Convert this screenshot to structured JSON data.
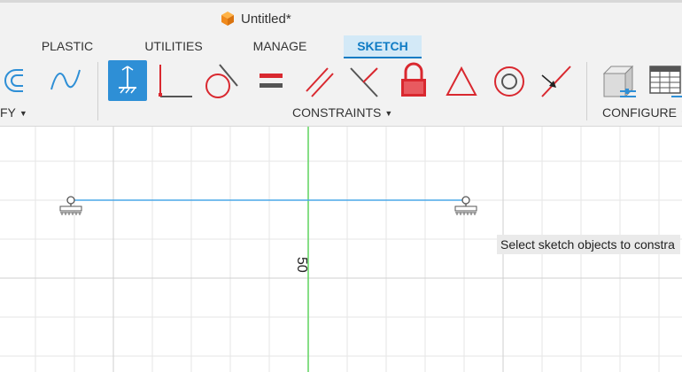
{
  "document": {
    "title": "Untitled*"
  },
  "tabs": [
    {
      "label": "PLASTIC",
      "active": false
    },
    {
      "label": "UTILITIES",
      "active": false
    },
    {
      "label": "MANAGE",
      "active": false
    },
    {
      "label": "SKETCH",
      "active": true
    }
  ],
  "toolbar": {
    "groups": {
      "modify": "FY",
      "constraints": "CONSTRAINTS",
      "configure": "CONFIGURE"
    },
    "tools": [
      {
        "icon": "arc-slot-icon",
        "active": false
      },
      {
        "icon": "spline-icon",
        "active": false
      },
      {
        "icon": "fix-unfix-icon",
        "active": true
      },
      {
        "icon": "perpendicular-icon",
        "active": false
      },
      {
        "icon": "tangent-icon",
        "active": false
      },
      {
        "icon": "equal-icon",
        "active": false
      },
      {
        "icon": "parallel-icon",
        "active": false
      },
      {
        "icon": "coincident-angle-icon",
        "active": false
      },
      {
        "icon": "lock-icon",
        "active": false
      },
      {
        "icon": "triangle-icon",
        "active": false
      },
      {
        "icon": "concentric-icon",
        "active": false
      },
      {
        "icon": "midpoint-icon",
        "active": false
      },
      {
        "icon": "configure-box-icon",
        "active": false
      },
      {
        "icon": "configure-table-icon",
        "active": false
      }
    ]
  },
  "canvas": {
    "dimension_value": "50",
    "tooltip": "Select sketch objects to constra"
  },
  "colors": {
    "accent": "#0f7bc4",
    "active_tab_bg": "#d3e9f7",
    "constraint_red": "#d9282f",
    "sketch_line": "#4aa8e8",
    "axis_green": "#5fd35f"
  }
}
